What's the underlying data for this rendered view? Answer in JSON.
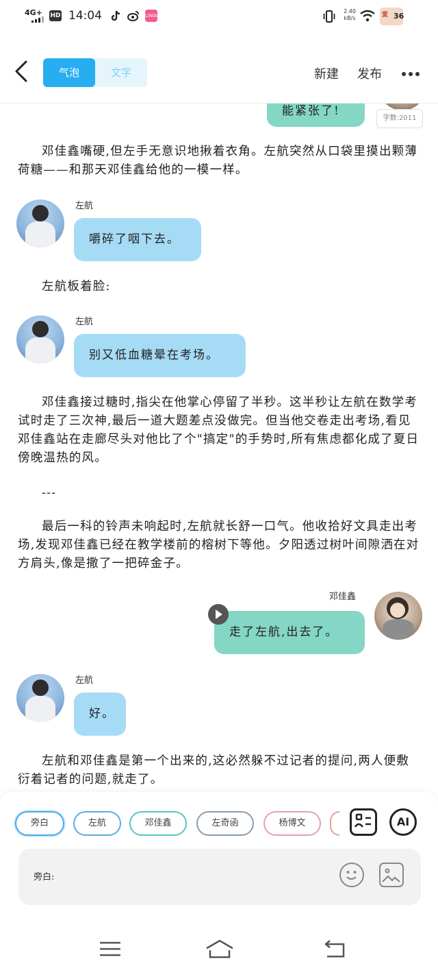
{
  "status_bar": {
    "network": "4G+",
    "hd": "HD",
    "time": "14:04",
    "pink_app": "LiNiAN",
    "speed_value": "2.40",
    "speed_unit": "kB/s",
    "battery": "36",
    "battery_tag": "爱"
  },
  "nav": {
    "tabs": [
      {
        "label": "气泡",
        "active": true
      },
      {
        "label": "文字",
        "active": false
      }
    ],
    "new_label": "新建",
    "publish_label": "发布"
  },
  "word_count": "字数:2011",
  "top_bubble_fragment": "能紧张了!",
  "story": {
    "p1": "邓佳鑫嘴硬,但左手无意识地揪着衣角。左航突然从口袋里摸出颗薄荷糖——和那天邓佳鑫给他的一模一样。",
    "m1_speaker": "左航",
    "m1_text": "嚼碎了咽下去。",
    "p2": "左航板着脸:",
    "m2_speaker": "左航",
    "m2_text": "别又低血糖晕在考场。",
    "p3": "邓佳鑫接过糖时,指尖在他掌心停留了半秒。这半秒让左航在数学考试时走了三次神,最后一道大题差点没做完。但当他交卷走出考场,看见邓佳鑫站在走廊尽头对他比了个\"搞定\"的手势时,所有焦虑都化成了夏日傍晚温热的风。",
    "sep": "---",
    "p4": "最后一科的铃声未响起时,左航就长舒一口气。他收拾好文具走出考场,发现邓佳鑫已经在教学楼前的榕树下等他。夕阳透过树叶间隙洒在对方肩头,像是撒了一把碎金子。",
    "m3_speaker": "邓佳鑫",
    "m3_text": "走了左航,出去了。",
    "m4_speaker": "左航",
    "m4_text": "好。",
    "p5": "左航和邓佳鑫是第一个出来的,这必然躲不过记者的提问,两人便敷衍着记者的问题,就走了。"
  },
  "characters": [
    "旁白",
    "左航",
    "邓佳鑫",
    "左奇函",
    "杨博文"
  ],
  "tools": {
    "ai_label": "AI"
  },
  "input": {
    "label": "旁白:",
    "placeholder": ""
  },
  "colors": {
    "accent": "#26aef0",
    "left_bubble": "#a6dbf6",
    "right_bubble": "#84d7c4"
  }
}
